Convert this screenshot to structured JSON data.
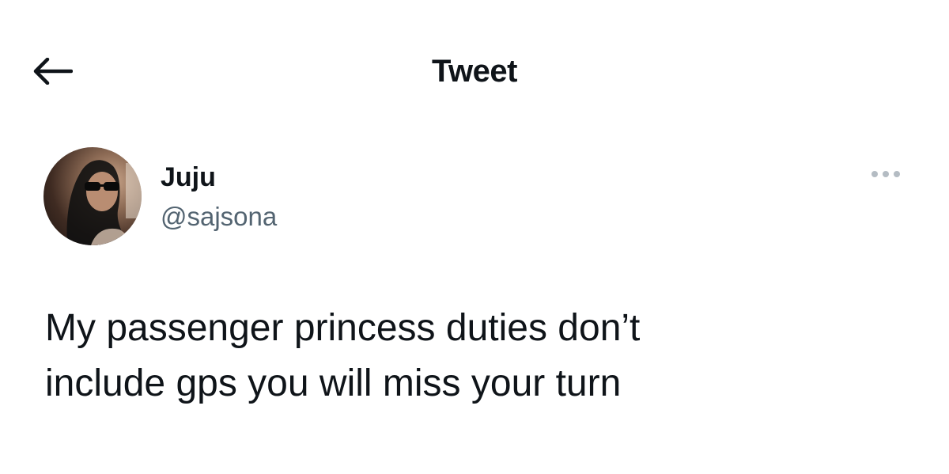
{
  "header": {
    "title": "Tweet"
  },
  "icons": {
    "back": "arrow-left-icon",
    "more": "more-horizontal-icon"
  },
  "author": {
    "name": "Juju",
    "handle": "@sajsona"
  },
  "tweet": {
    "text_line_1": "My passenger princess duties don’t",
    "text_line_2": "include gps you will miss your turn"
  },
  "colors": {
    "text": "#0f1419",
    "secondary_text": "#536471",
    "icon_gray": "#b4bcc3",
    "background": "#ffffff"
  }
}
